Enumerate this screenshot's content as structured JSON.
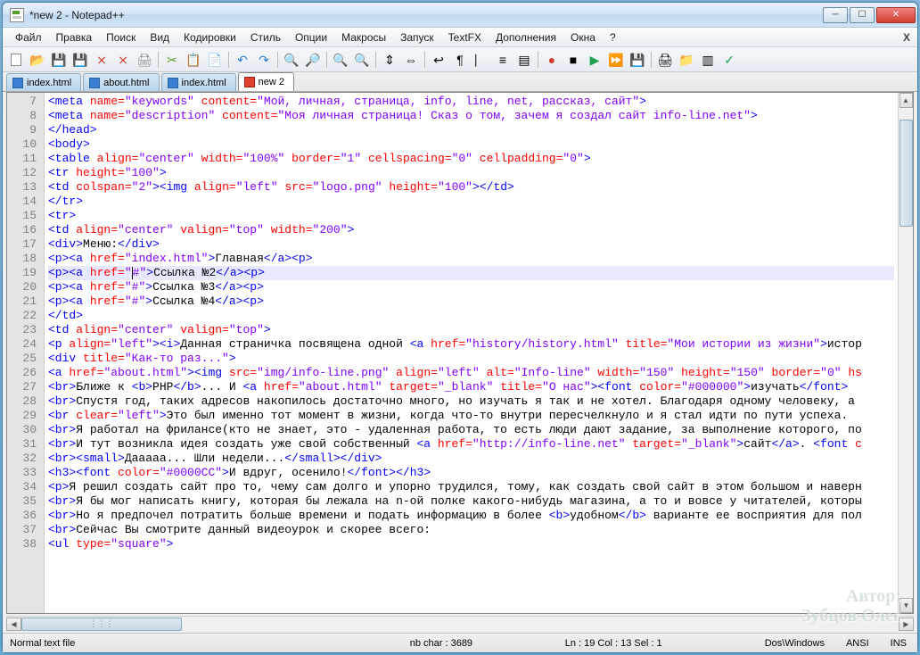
{
  "window": {
    "title": "*new 2 - Notepad++"
  },
  "menu": {
    "items": [
      "Файл",
      "Правка",
      "Поиск",
      "Вид",
      "Кодировки",
      "Стиль",
      "Опции",
      "Макросы",
      "Запуск",
      "TextFX",
      "Дополнения",
      "Окна",
      "?"
    ]
  },
  "tabs": [
    {
      "label": "index.html",
      "active": false,
      "icontype": "blue"
    },
    {
      "label": "about.html",
      "active": false,
      "icontype": "blue"
    },
    {
      "label": "index.html",
      "active": false,
      "icontype": "blue"
    },
    {
      "label": "new 2",
      "active": true,
      "icontype": "red"
    }
  ],
  "gutter_start": 7,
  "code_lines": [
    {
      "n": 7,
      "html": "<span class='tag'>&lt;meta</span> <span class='attr'>name=</span><span class='val'>\"keywords\"</span> <span class='attr'>content=</span><span class='val'>\"Мой, личная, страница, info, line, net, рассказ, сайт\"</span><span class='tag'>&gt;</span>"
    },
    {
      "n": 8,
      "html": "<span class='tag'>&lt;meta</span> <span class='attr'>name=</span><span class='val'>\"description\"</span> <span class='attr'>content=</span><span class='val'>\"Моя личная страница! Сказ о том, зачем я создал сайт info-line.net\"</span><span class='tag'>&gt;</span>"
    },
    {
      "n": 9,
      "html": "<span class='tag'>&lt;/head&gt;</span>"
    },
    {
      "n": 10,
      "html": "<span class='tag'>&lt;body&gt;</span>"
    },
    {
      "n": 11,
      "html": "<span class='tag'>&lt;table</span> <span class='attr'>align=</span><span class='val'>\"center\"</span> <span class='attr'>width=</span><span class='val'>\"100%\"</span> <span class='attr'>border=</span><span class='val'>\"1\"</span> <span class='attr'>cellspacing=</span><span class='val'>\"0\"</span> <span class='attr'>cellpadding=</span><span class='val'>\"0\"</span><span class='tag'>&gt;</span>"
    },
    {
      "n": 12,
      "html": "<span class='tag'>&lt;tr</span> <span class='attr'>height=</span><span class='val'>\"100\"</span><span class='tag'>&gt;</span>"
    },
    {
      "n": 13,
      "html": "<span class='tag'>&lt;td</span> <span class='attr'>colspan=</span><span class='val'>\"2\"</span><span class='tag'>&gt;&lt;img</span> <span class='attr'>align=</span><span class='val'>\"left\"</span> <span class='attr'>src=</span><span class='val'>\"logo.png\"</span> <span class='attr'>height=</span><span class='val'>\"100\"</span><span class='tag'>&gt;&lt;/td&gt;</span>"
    },
    {
      "n": 14,
      "html": "<span class='tag'>&lt;/tr&gt;</span>"
    },
    {
      "n": 15,
      "html": "<span class='tag'>&lt;tr&gt;</span>"
    },
    {
      "n": 16,
      "html": "<span class='tag'>&lt;td</span> <span class='attr'>align=</span><span class='val'>\"center\"</span> <span class='attr'>valign=</span><span class='val'>\"top\"</span> <span class='attr'>width=</span><span class='val'>\"200\"</span><span class='tag'>&gt;</span>"
    },
    {
      "n": 17,
      "html": "<span class='tag'>&lt;div&gt;</span><span class='plain'>Меню:</span><span class='tag'>&lt;/div&gt;</span>"
    },
    {
      "n": 18,
      "html": "<span class='tag'>&lt;p&gt;&lt;a</span> <span class='attr'>href=</span><span class='val'>\"index.html\"</span><span class='tag'>&gt;</span><span class='plain'>Главная</span><span class='tag'>&lt;/a&gt;&lt;p&gt;</span>"
    },
    {
      "n": 19,
      "html": "<span class='tag'>&lt;p&gt;&lt;a</span> <span class='attr'>href=</span><span class='val'>\"</span><span class='cursor'></span><span class='val'>#\"</span><span class='tag'>&gt;</span><span class='plain'>Ссылка №2</span><span class='tag'>&lt;/a&gt;&lt;p&gt;</span>",
      "current": true
    },
    {
      "n": 20,
      "html": "<span class='tag'>&lt;p&gt;&lt;a</span> <span class='attr'>href=</span><span class='val'>\"#\"</span><span class='tag'>&gt;</span><span class='plain'>Ссылка №3</span><span class='tag'>&lt;/a&gt;&lt;p&gt;</span>"
    },
    {
      "n": 21,
      "html": "<span class='tag'>&lt;p&gt;&lt;a</span> <span class='attr'>href=</span><span class='val'>\"#\"</span><span class='tag'>&gt;</span><span class='plain'>Ссылка №4</span><span class='tag'>&lt;/a&gt;&lt;p&gt;</span>"
    },
    {
      "n": 22,
      "html": "<span class='tag'>&lt;/td&gt;</span>"
    },
    {
      "n": 23,
      "html": "<span class='tag'>&lt;td</span> <span class='attr'>align=</span><span class='val'>\"center\"</span> <span class='attr'>valign=</span><span class='val'>\"top\"</span><span class='tag'>&gt;</span>"
    },
    {
      "n": 24,
      "html": "<span class='tag'>&lt;p</span> <span class='attr'>align=</span><span class='val'>\"left\"</span><span class='tag'>&gt;&lt;i&gt;</span><span class='plain'>Данная страничка посвящена одной </span><span class='tag'>&lt;a</span> <span class='attr'>href=</span><span class='val'>\"history/history.html\"</span> <span class='attr'>title=</span><span class='val'>\"Мои истории из жизни\"</span><span class='tag'>&gt;</span><span class='plain'>истор</span>"
    },
    {
      "n": 25,
      "html": "<span class='tag'>&lt;div</span> <span class='attr'>title=</span><span class='val'>\"Как-то раз...\"</span><span class='tag'>&gt;</span>"
    },
    {
      "n": 26,
      "html": "<span class='tag'>&lt;a</span> <span class='attr'>href=</span><span class='val'>\"about.html\"</span><span class='tag'>&gt;&lt;img</span> <span class='attr'>src=</span><span class='val'>\"img/info-line.png\"</span> <span class='attr'>align=</span><span class='val'>\"left\"</span> <span class='attr'>alt=</span><span class='val'>\"Info-line\"</span> <span class='attr'>width=</span><span class='val'>\"150\"</span> <span class='attr'>height=</span><span class='val'>\"150\"</span> <span class='attr'>border=</span><span class='val'>\"0\"</span> <span class='attr'>hs</span>"
    },
    {
      "n": 27,
      "html": "<span class='tag'>&lt;br&gt;</span><span class='plain'>Ближе к </span><span class='tag'>&lt;b&gt;</span><span class='plain'>PHP</span><span class='tag'>&lt;/b&gt;</span><span class='plain'>... И </span><span class='tag'>&lt;a</span> <span class='attr'>href=</span><span class='val'>\"about.html\"</span> <span class='attr'>target=</span><span class='val'>\"_blank\"</span> <span class='attr'>title=</span><span class='val'>\"О нас\"</span><span class='tag'>&gt;&lt;font</span> <span class='attr'>color=</span><span class='val'>\"#000000\"</span><span class='tag'>&gt;</span><span class='plain'>изучать</span><span class='tag'>&lt;/font&gt;</span>"
    },
    {
      "n": 28,
      "html": "<span class='tag'>&lt;br&gt;</span><span class='plain'>Спустя год, таких адресов накопилось достаточно много, но изучать я так и не хотел. Благодаря одному человеку, а </span>"
    },
    {
      "n": 29,
      "html": "<span class='tag'>&lt;br</span> <span class='attr'>clear=</span><span class='val'>\"left\"</span><span class='tag'>&gt;</span><span class='plain'>Это был именно тот момент в жизни, когда что-то внутри пересчелкнуло и я стал идти по пути успеха.</span>"
    },
    {
      "n": 30,
      "html": "<span class='tag'>&lt;br&gt;</span><span class='plain'>Я работал на фрилансе(кто не знает, это - удаленная работа, то есть люди дают задание, за выполнение которого, по</span>"
    },
    {
      "n": 31,
      "html": "<span class='tag'>&lt;br&gt;</span><span class='plain'>И тут возникла идея создать уже свой собственный </span><span class='tag'>&lt;a</span> <span class='attr'>href=</span><span class='val'>\"http://info-line.net\"</span> <span class='attr'>target=</span><span class='val'>\"_blank\"</span><span class='tag'>&gt;</span><span class='plain'>сайт</span><span class='tag'>&lt;/a&gt;</span><span class='plain'>. </span><span class='tag'>&lt;font</span> <span class='attr'>c</span>"
    },
    {
      "n": 32,
      "html": "<span class='tag'>&lt;br&gt;&lt;small&gt;</span><span class='plain'>Дааааа... Шли недели...</span><span class='tag'>&lt;/small&gt;&lt;/div&gt;</span>"
    },
    {
      "n": 33,
      "html": "<span class='tag'>&lt;h3&gt;&lt;font</span> <span class='attr'>color=</span><span class='val'>\"#0000CC\"</span><span class='tag'>&gt;</span><span class='plain'>И вдруг, осенило!</span><span class='tag'>&lt;/font&gt;&lt;/h3&gt;</span>"
    },
    {
      "n": 34,
      "html": "<span class='tag'>&lt;p&gt;</span><span class='plain'>Я решил создать сайт про то, чему сам долго и упорно трудился, тому, как создать свой сайт в этом большом и наверн</span>"
    },
    {
      "n": 35,
      "html": "<span class='tag'>&lt;br&gt;</span><span class='plain'>Я бы мог написать книгу, которая бы лежала на n-ой полке какого-нибудь магазина, а то и вовсе у читателей, которы</span>"
    },
    {
      "n": 36,
      "html": "<span class='tag'>&lt;br&gt;</span><span class='plain'>Но я предпочел потратить больше времени и подать информацию в более </span><span class='tag'>&lt;b&gt;</span><span class='plain'>удобном</span><span class='tag'>&lt;/b&gt;</span><span class='plain'> варианте ее восприятия для пол</span>"
    },
    {
      "n": 37,
      "html": "<span class='tag'>&lt;br&gt;</span><span class='plain'>Сейчас Вы смотрите данный видеоурок и скорее всего:</span>"
    },
    {
      "n": 38,
      "html": "<span class='tag'>&lt;ul</span> <span class='attr'>type=</span><span class='val'>\"square\"</span><span class='tag'>&gt;</span>"
    }
  ],
  "statusbar": {
    "filetype": "Normal text file",
    "nbchar": "nb char : 3689",
    "pos": "Ln : 19   Col : 13   Sel : 1",
    "eol": "Dos\\Windows",
    "enc": "ANSI",
    "mode": "INS"
  },
  "watermark": {
    "line1": "Автор:",
    "line2": "Зубцов Олег"
  }
}
